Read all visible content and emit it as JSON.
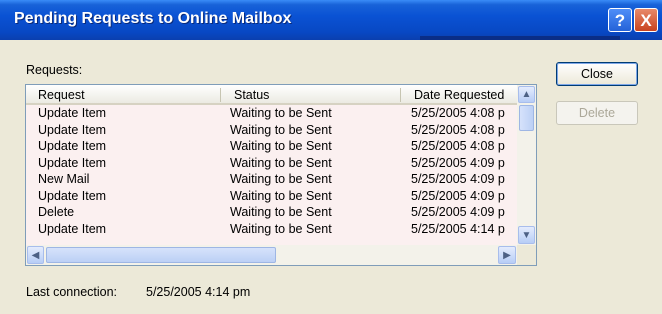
{
  "window": {
    "title": "Pending Requests to Online Mailbox"
  },
  "titlebar_buttons": {
    "help": "?",
    "close": "X"
  },
  "requests_label": "Requests:",
  "columns": [
    "Request",
    "Status",
    "Date Requested"
  ],
  "rows": [
    {
      "request": "Update Item",
      "status": "Waiting to be Sent",
      "date": "5/25/2005 4:08 p"
    },
    {
      "request": "Update Item",
      "status": "Waiting to be Sent",
      "date": "5/25/2005 4:08 p"
    },
    {
      "request": "Update Item",
      "status": "Waiting to be Sent",
      "date": "5/25/2005 4:08 p"
    },
    {
      "request": "Update Item",
      "status": "Waiting to be Sent",
      "date": "5/25/2005 4:09 p"
    },
    {
      "request": "New Mail",
      "status": "Waiting to be Sent",
      "date": "5/25/2005 4:09 p"
    },
    {
      "request": "Update Item",
      "status": "Waiting to be Sent",
      "date": "5/25/2005 4:09 p"
    },
    {
      "request": "Delete",
      "status": "Waiting to be Sent",
      "date": "5/25/2005 4:09 p"
    },
    {
      "request": "Update Item",
      "status": "Waiting to be Sent",
      "date": "5/25/2005 4:14 p"
    }
  ],
  "buttons": {
    "close": "Close",
    "delete": "Delete"
  },
  "last_connection": {
    "label": "Last connection:",
    "value": "5/25/2005 4:14 pm"
  },
  "colors": {
    "titlebar": "#0a52d4",
    "dialog_bg": "#ece9d8",
    "list_bg": "#fbf0f0"
  },
  "icons": {
    "up": "scroll-up-icon",
    "down": "scroll-down-icon",
    "left": "scroll-left-icon",
    "right": "scroll-right-icon"
  }
}
